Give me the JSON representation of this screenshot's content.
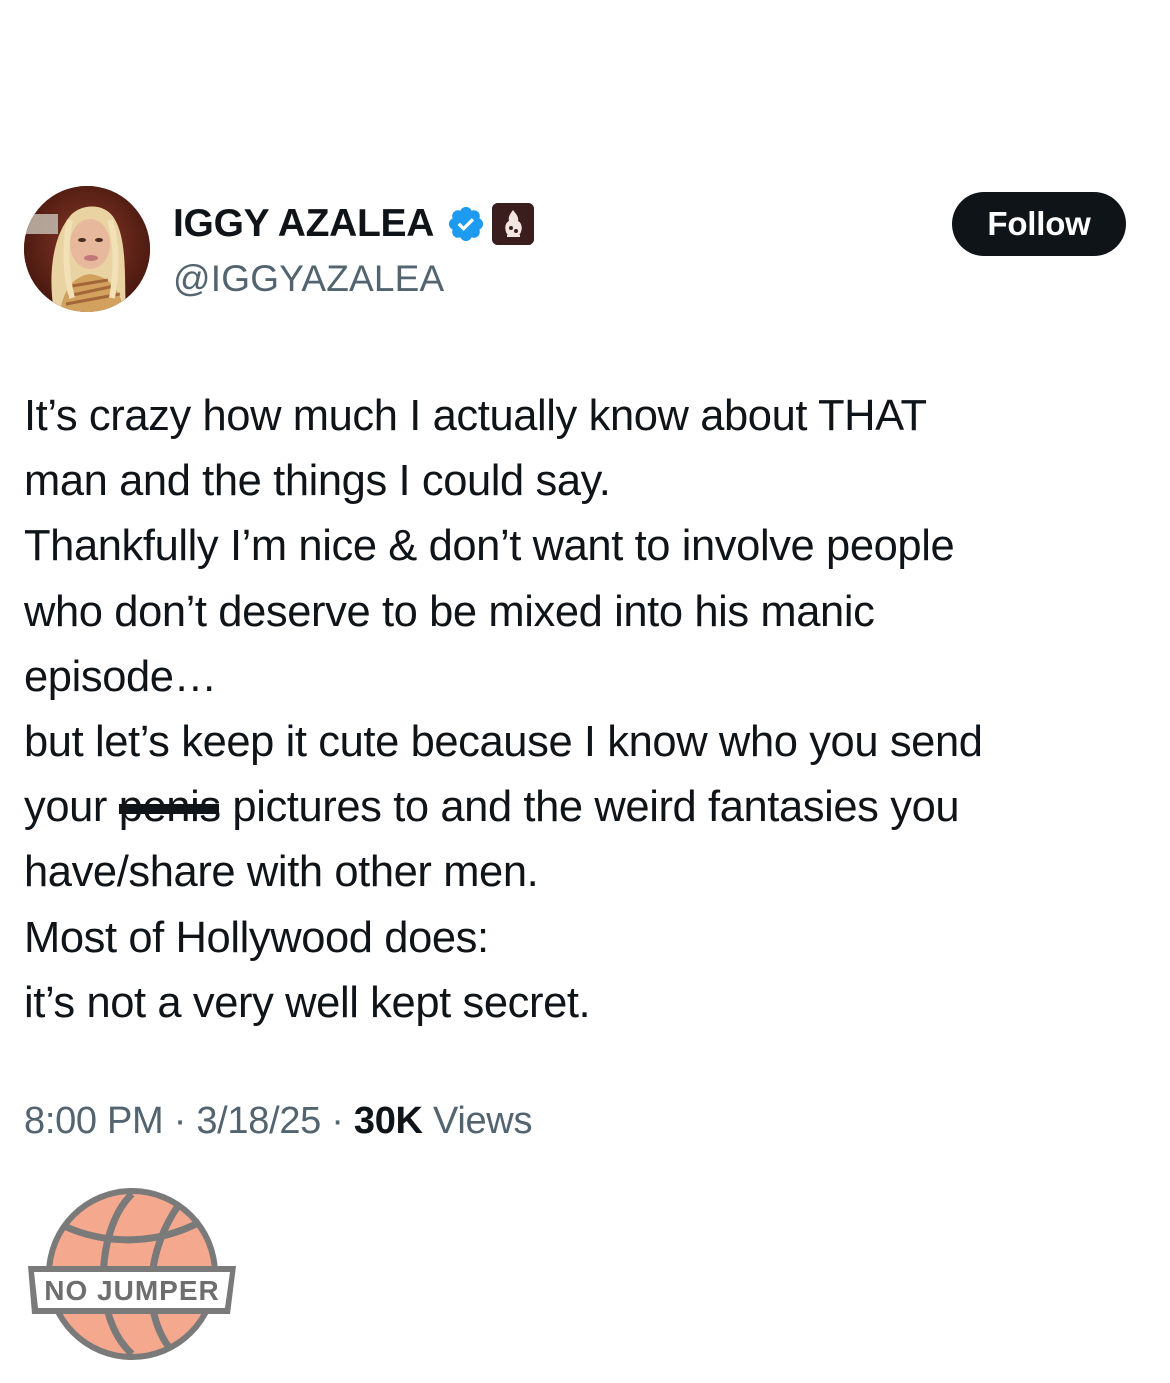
{
  "author": {
    "display_name": "IGGY AZALEA",
    "handle": "@IGGYAZALEA",
    "verified": true,
    "badge_icon": "affiliate-badge-icon",
    "colors": {
      "verified": "#1d9bf0",
      "affiliate_badge": "#3a1e1d"
    }
  },
  "follow_button": {
    "label": "Follow",
    "bg_color": "#0f1419"
  },
  "tweet": {
    "lines": [
      "It’s crazy how much I actually know about THAT",
      "man and the things I could say.",
      "Thankfully I’m nice & don’t want to involve people",
      "who don’t deserve to be mixed into his manic",
      "episode…",
      "but let’s keep it cute because I know who you send"
    ],
    "redacted_line": {
      "before": "your ",
      "redacted": "penis",
      "after": " pictures to and the weird fantasies you"
    },
    "lines_after": [
      "have/share with other men.",
      "Most of Hollywood does:",
      "it’s not a very well kept secret."
    ]
  },
  "meta": {
    "time": "8:00 PM",
    "separator": "·",
    "date": "3/18/25",
    "views_count": "30K",
    "views_label": "Views"
  },
  "watermark": {
    "text": "NO JUMPER",
    "ball_color": "#f4a88d"
  }
}
